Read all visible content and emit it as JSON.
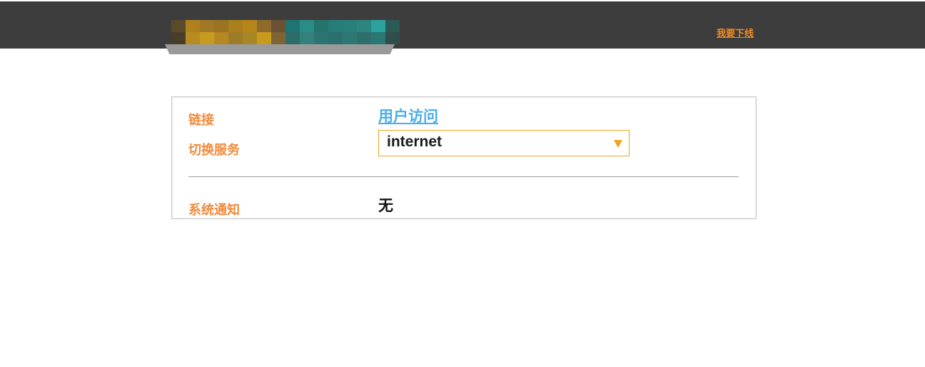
{
  "header": {
    "logout_label": "我要下线",
    "logo_colors": {
      "gold": [
        "#5a4a2a",
        "#b07f1e",
        "#a07826",
        "#9b7321",
        "#a9801c",
        "#b5851a",
        "#8f6a2b",
        "#6a5334",
        "#1e7470",
        "#2a8c86",
        "#26726c",
        "#277e78",
        "#2a7f7a",
        "#2b8580",
        "#2ba29c",
        "#2c5a57"
      ],
      "row2": [
        "#4a3d28",
        "#b68b20",
        "#c89a1f",
        "#b58920",
        "#9d7c27",
        "#a78624",
        "#c99a1c",
        "#806334",
        "#2c6d69",
        "#33807c",
        "#2c7470",
        "#2b706c",
        "#2f7772",
        "#2d6f6b",
        "#2b7873",
        "#304e4b"
      ]
    }
  },
  "panel": {
    "link_label": "链接",
    "access_link": "用户访问",
    "switch_label": "切换服务",
    "service_value": "internet",
    "notice_label": "系统通知",
    "notice_value": "无"
  }
}
